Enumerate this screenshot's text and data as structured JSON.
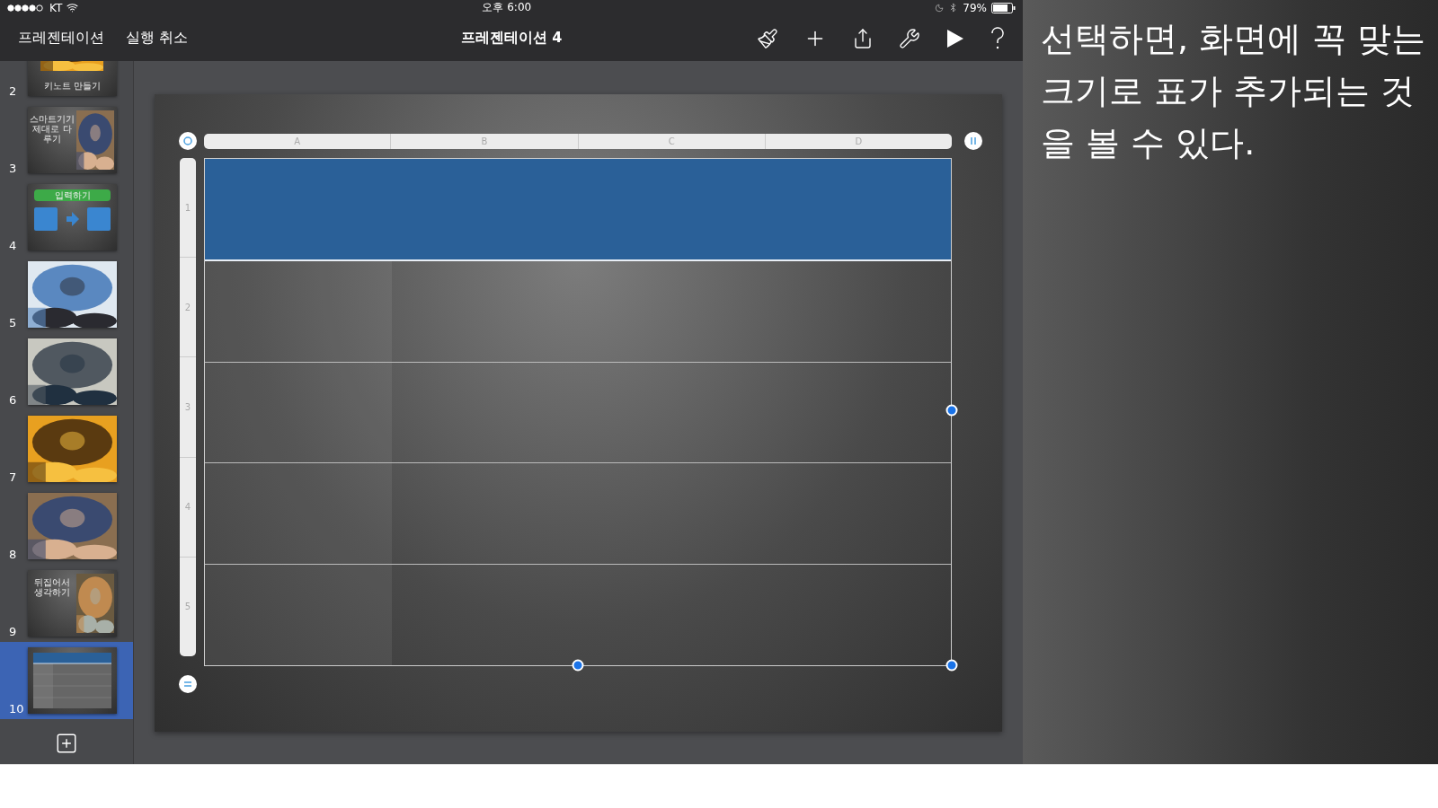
{
  "status_bar": {
    "carrier": "KT",
    "time": "오후 6:00",
    "battery": "79%"
  },
  "toolbar": {
    "left_buttons": [
      "프레젠테이션",
      "실행 취소"
    ],
    "title": "프레젠테이션 4"
  },
  "slides": [
    {
      "number": "2",
      "kind": "caption_photo",
      "texts": [
        "키노트 만들기"
      ],
      "selected": false
    },
    {
      "number": "3",
      "kind": "text_photo",
      "texts": [
        "스마트기기 제대로 다루기"
      ],
      "selected": false
    },
    {
      "number": "4",
      "kind": "diagram",
      "texts": [
        "입력하기"
      ],
      "selected": false
    },
    {
      "number": "5",
      "selected": false
    },
    {
      "number": "6",
      "selected": false
    },
    {
      "number": "7",
      "selected": false
    },
    {
      "number": "8",
      "selected": false
    },
    {
      "number": "9",
      "kind": "text_photo",
      "texts": [
        "뒤집어서 생각하기"
      ],
      "selected": false
    },
    {
      "number": "10",
      "kind": "table",
      "selected": true
    }
  ],
  "table": {
    "columns": [
      "A",
      "B",
      "C",
      "D"
    ],
    "rows": [
      {
        "label": "1",
        "selected": true
      },
      {
        "label": "2",
        "selected": false
      },
      {
        "label": "3",
        "selected": false
      },
      {
        "label": "4",
        "selected": false
      },
      {
        "label": "5",
        "selected": false
      }
    ]
  },
  "caption": "선택하면, 화면에 꼭 맞는 크기로 표가 추가되는 것을 볼 수 있다."
}
